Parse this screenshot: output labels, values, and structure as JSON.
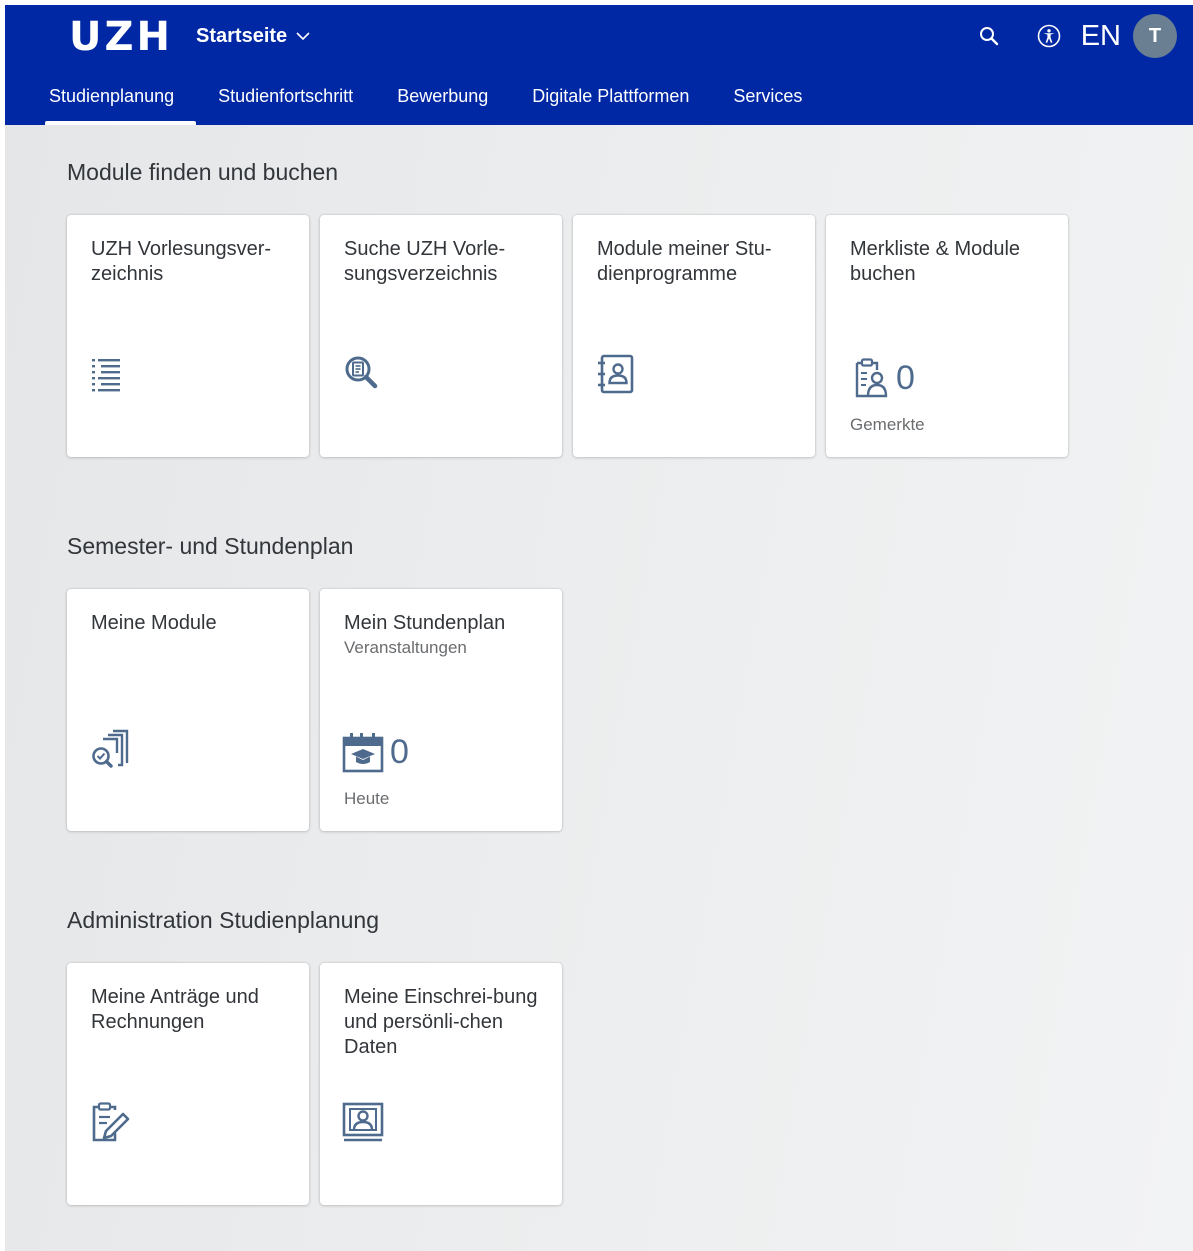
{
  "shell": {
    "logo": "UZH",
    "app_title": "Startseite",
    "language": "EN",
    "avatar_initial": "T"
  },
  "tabs": [
    {
      "label": "Studienplanung"
    },
    {
      "label": "Studienfortschritt"
    },
    {
      "label": "Bewerbung"
    },
    {
      "label": "Digitale Plattformen"
    },
    {
      "label": "Services"
    }
  ],
  "sections": [
    {
      "title": "Module finden und buchen",
      "tiles": [
        {
          "title": "UZH Vorlesungsver-zeichnis",
          "icon": "list-icon"
        },
        {
          "title": "Suche UZH Vorle-sungsverzeichnis",
          "icon": "search-document-icon"
        },
        {
          "title": "Module meiner Stu-dienprogramme",
          "icon": "address-book-icon"
        },
        {
          "title": "Merkliste & Module buchen",
          "icon": "clipboard-person-icon",
          "value": "0",
          "footer": "Gemerkte"
        }
      ]
    },
    {
      "title": "Semester- und Stundenplan",
      "tiles": [
        {
          "title": "Meine Module",
          "icon": "documents-search-icon"
        },
        {
          "title": "Mein Stundenplan",
          "subtitle": "Veranstaltungen",
          "icon": "calendar-education-icon",
          "value": "0",
          "footer": "Heute"
        }
      ]
    },
    {
      "title": "Administration Studienplanung",
      "tiles": [
        {
          "title": "Meine Anträge und Rechnungen",
          "icon": "form-edit-icon"
        },
        {
          "title": "Meine Einschrei-bung und persönli-chen Daten",
          "icon": "person-card-icon"
        }
      ]
    }
  ],
  "colors": {
    "shell": "#0028a5",
    "icon": "#4e6a8c",
    "text": "#32363a"
  }
}
